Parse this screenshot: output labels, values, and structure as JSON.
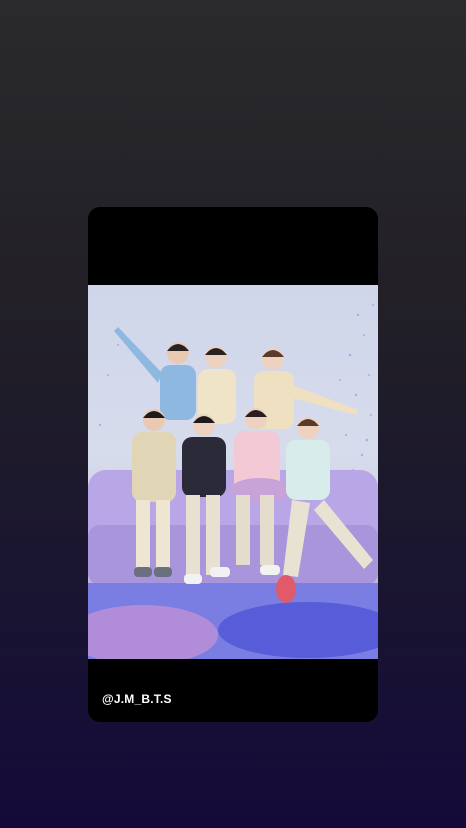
{
  "story": {
    "credit_text": "@J.M_B.T.S"
  },
  "colors": {
    "background_top": "#2a2a2c",
    "background_bottom": "#140a3a",
    "card": "#000000",
    "sofa": "#b7a3e4",
    "floor_confetti": "#6a6fe0"
  },
  "image": {
    "description_icon": "group-photo"
  }
}
